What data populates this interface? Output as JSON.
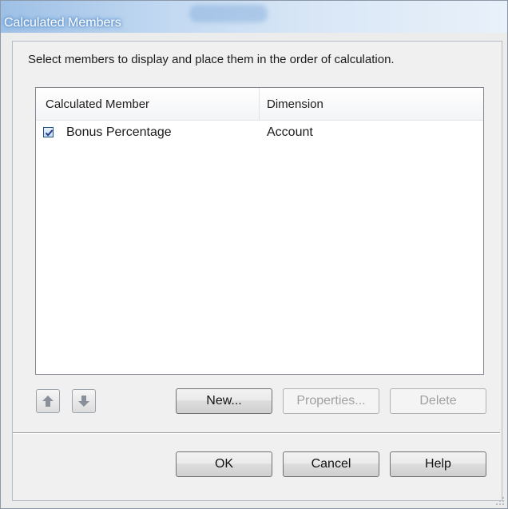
{
  "window": {
    "title": "Calculated Members"
  },
  "instruction": "Select members to display and place them in the order of calculation.",
  "list": {
    "columns": [
      "Calculated Member",
      "Dimension"
    ],
    "rows": [
      {
        "checked": true,
        "member": "Bonus Percentage",
        "dimension": "Account"
      }
    ]
  },
  "order_buttons": {
    "move_up_icon": "arrow-up-icon",
    "move_down_icon": "arrow-down-icon"
  },
  "actions": {
    "new_label": "New...",
    "properties_label": "Properties...",
    "delete_label": "Delete"
  },
  "footer": {
    "ok_label": "OK",
    "cancel_label": "Cancel",
    "help_label": "Help"
  },
  "colors": {
    "title_gradient_start": "#9ec0e6",
    "dialog_background": "#ececec",
    "arrow_icon": "#8a9099"
  }
}
